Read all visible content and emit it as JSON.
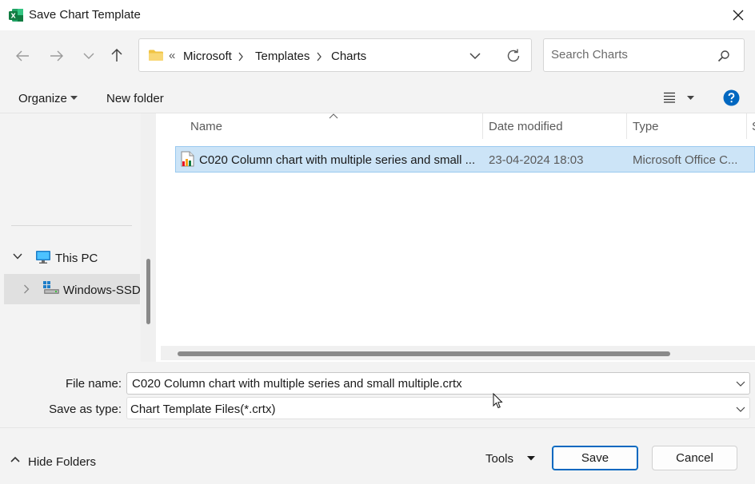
{
  "window": {
    "title": "Save Chart Template",
    "app_icon": "excel-icon",
    "accent_color": "#0067c0",
    "selection_color": "#cce4f7"
  },
  "nav": {
    "back_icon": "arrow-left-icon",
    "forward_icon": "arrow-right-icon",
    "recent_icon": "chevron-down-icon",
    "up_icon": "arrow-up-icon"
  },
  "address": {
    "overflow": "«",
    "crumbs": [
      "Microsoft",
      "Templates",
      "Charts"
    ]
  },
  "search": {
    "placeholder": "Search Charts"
  },
  "commands": {
    "organize": "Organize",
    "new_folder": "New folder"
  },
  "navpane": {
    "items": [
      {
        "label": "This PC",
        "icon": "computer-icon",
        "expanded": true
      },
      {
        "label": "Windows-SSD",
        "icon": "drive-icon",
        "expanded": false,
        "selected": true
      }
    ]
  },
  "filelist": {
    "columns": [
      "Name",
      "Date modified",
      "Type",
      "S"
    ],
    "files": [
      {
        "name": "C020 Column chart with multiple series and small ...",
        "date_modified": "23-04-2024 18:03",
        "type": "Microsoft Office C...",
        "icon": "chart-template-icon"
      }
    ]
  },
  "form": {
    "file_name_label": "File name:",
    "file_name_value": "C020 Column chart with multiple series and small multiple.crtx",
    "save_type_label": "Save as type:",
    "save_type_value": "Chart Template Files(*.crtx)"
  },
  "footer": {
    "hide_folders": "Hide Folders",
    "tools": "Tools",
    "save": "Save",
    "cancel": "Cancel"
  }
}
